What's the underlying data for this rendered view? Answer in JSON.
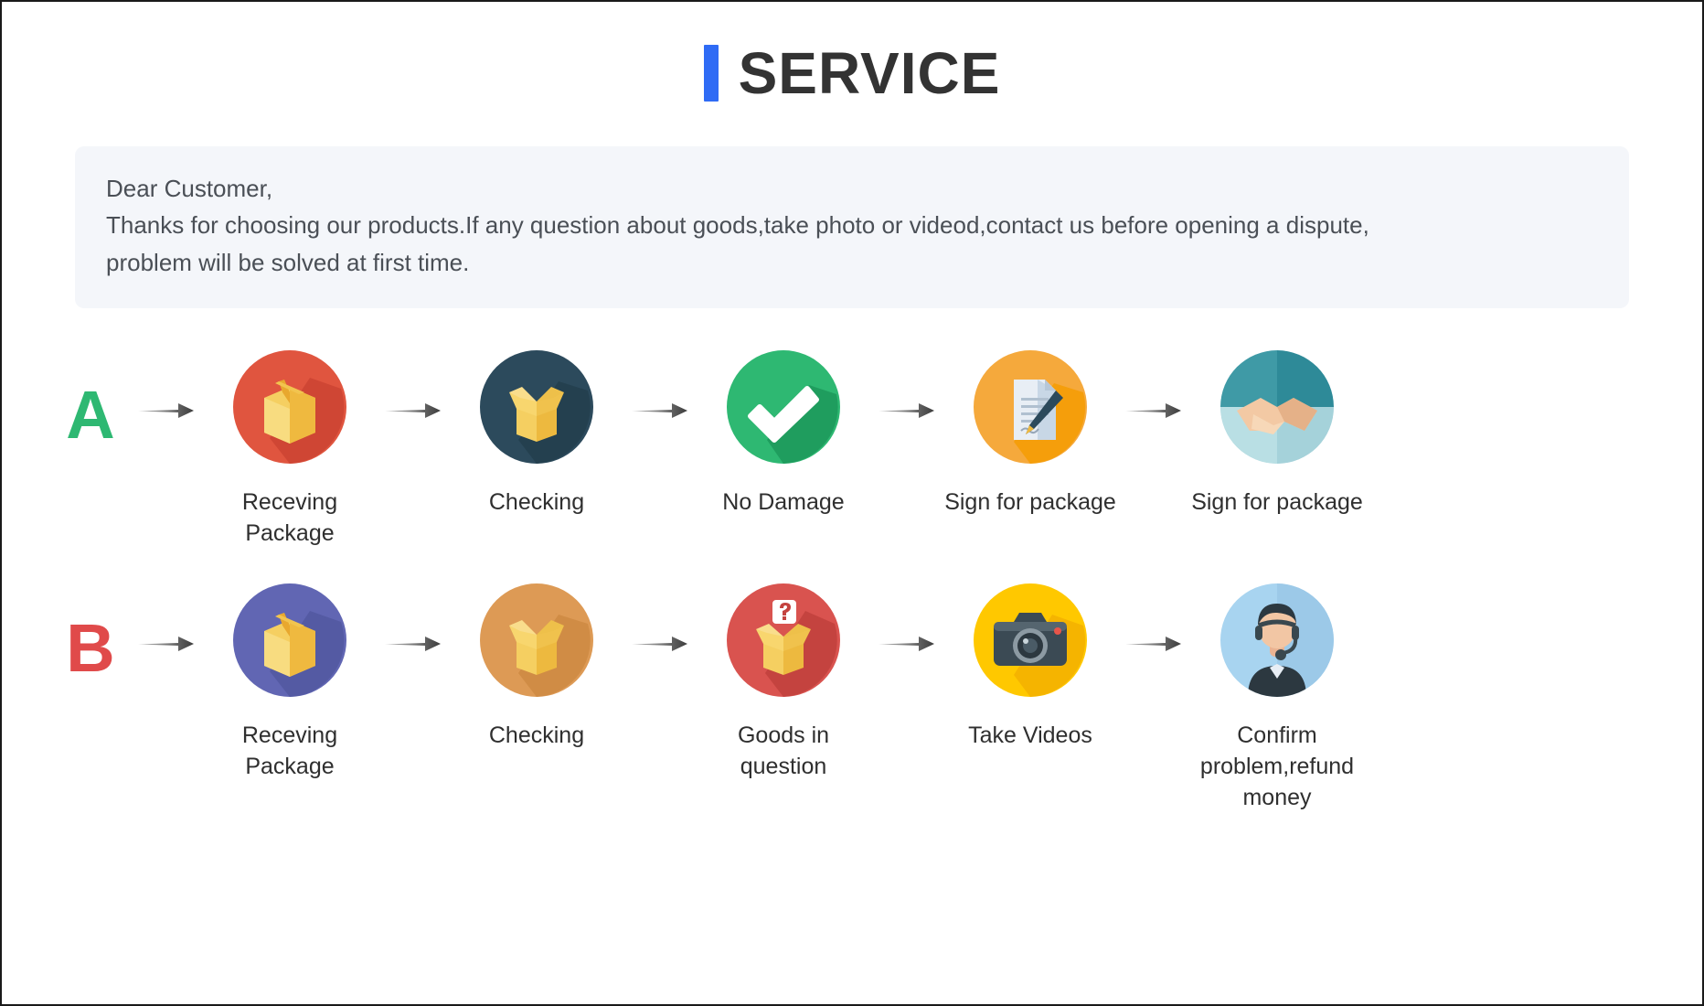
{
  "header": {
    "title": "SERVICE",
    "accent_color": "#2f6bf5",
    "title_color": "#333333"
  },
  "notice": {
    "background": "#f4f6fa",
    "lines": [
      "Dear Customer,",
      "Thanks for choosing our products.If any question about goods,take photo or videod,contact us before opening a dispute,",
      "problem will be solved at first time."
    ]
  },
  "flows": [
    {
      "letter": "A",
      "letter_color": "#2eb872",
      "steps": [
        {
          "label": "Receving Package",
          "icon": "closed-box-icon",
          "circle_color": "#e0553f"
        },
        {
          "label": "Checking",
          "icon": "open-box-icon",
          "circle_color": "#2c4a5c"
        },
        {
          "label": "No Damage",
          "icon": "checkmark-icon",
          "circle_color": "#2eb872"
        },
        {
          "label": "Sign for package",
          "icon": "document-pen-icon",
          "circle_color": "#f5a93c"
        },
        {
          "label": "Sign for package",
          "icon": "handshake-icon",
          "circle_color": "#a8d4dc"
        }
      ]
    },
    {
      "letter": "B",
      "letter_color": "#e04a4a",
      "steps": [
        {
          "label": "Receving Package",
          "icon": "closed-box-icon",
          "circle_color": "#6166b3"
        },
        {
          "label": "Checking",
          "icon": "open-box-icon",
          "circle_color": "#dd9a55"
        },
        {
          "label": "Goods in question",
          "icon": "question-box-icon",
          "circle_color": "#d9534f"
        },
        {
          "label": "Take Videos",
          "icon": "camera-icon",
          "circle_color": "#ffc800"
        },
        {
          "label": "Confirm problem,refund money",
          "icon": "support-agent-icon",
          "circle_color": "#a8d4f0"
        }
      ]
    }
  ],
  "arrow": {
    "name": "arrow-right-icon",
    "color": "#4a4a4a"
  }
}
